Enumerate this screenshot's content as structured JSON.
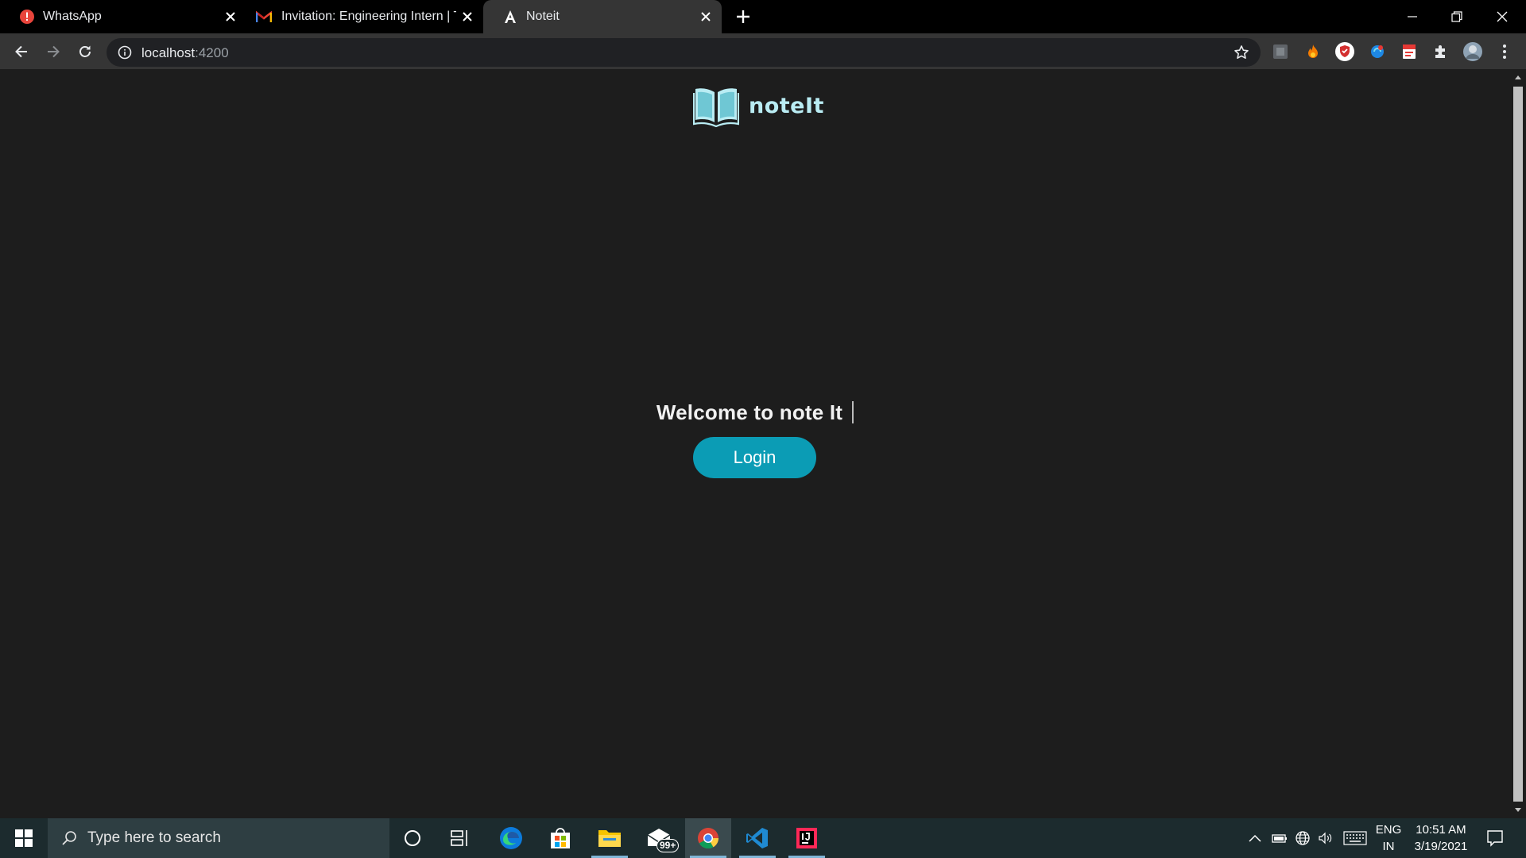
{
  "browser": {
    "tabs": [
      {
        "title": "WhatsApp",
        "icon": "whatsapp-alert-icon"
      },
      {
        "title": "Invitation: Engineering Intern | Te",
        "icon": "gmail-icon"
      },
      {
        "title": "Noteit",
        "icon": "angular-icon",
        "active": true
      }
    ],
    "address": {
      "host": "localhost",
      "port": ":4200"
    }
  },
  "page": {
    "brand_name": "noteIt",
    "welcome": "Welcome to note It",
    "login_label": "Login"
  },
  "taskbar": {
    "search_placeholder": "Type here to search",
    "mail_badge": "99+",
    "lang_line1": "ENG",
    "lang_line2": "IN",
    "time": "10:51 AM",
    "date": "3/19/2021"
  },
  "colors": {
    "accent": "#0b9cb5",
    "brand": "#b9ecf3",
    "page_bg": "#1d1d1d"
  }
}
